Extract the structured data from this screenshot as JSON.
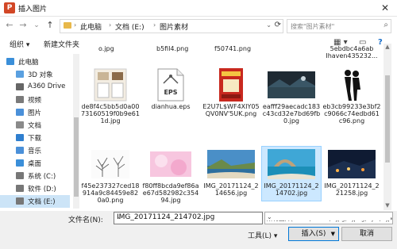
{
  "window": {
    "title": "插入图片",
    "app_icon_letter": "P",
    "close_glyph": "✕"
  },
  "nav": {
    "back_glyph": "←",
    "forward_glyph": "→",
    "dropdown_glyph": "⌄",
    "up_glyph": "↑",
    "breadcrumbs": [
      "此电脑",
      "文档 (E:)",
      "图片素材"
    ],
    "sep_glyph": "›",
    "refresh_glyph": "⟳",
    "search_placeholder": "搜索\"图片素材\""
  },
  "toolbar": {
    "organize": "组织 ▾",
    "new_folder": "新建文件夹",
    "view_glyph": "▦ ▾",
    "pane_glyph": "▭",
    "help_glyph": "?"
  },
  "sidebar": {
    "items": [
      {
        "label": "此电脑",
        "color": "#3b8fd9"
      },
      {
        "label": "3D 对象",
        "color": "#5aa0e0"
      },
      {
        "label": "A360 Drive",
        "color": "#666666"
      },
      {
        "label": "视频",
        "color": "#7a7a7a"
      },
      {
        "label": "图片",
        "color": "#4a90d9"
      },
      {
        "label": "文档",
        "color": "#8a8a8a"
      },
      {
        "label": "下载",
        "color": "#2f7fcf"
      },
      {
        "label": "音乐",
        "color": "#4a90d9"
      },
      {
        "label": "桌面",
        "color": "#3b8fd9"
      },
      {
        "label": "系统 (C:)",
        "color": "#777777"
      },
      {
        "label": "软件 (D:)",
        "color": "#777777"
      },
      {
        "label": "文档 (E:)",
        "color": "#777777"
      }
    ]
  },
  "files": {
    "prev_row": [
      "o.jpg",
      "b5fil4.png",
      "f50741.png",
      "5ebdbc4a6ab Ihaven435232..."
    ],
    "items": [
      {
        "name": "de8f4c5bb5d0a0073160519f0b9e611d.jpg",
        "thumb": "collage"
      },
      {
        "name": "dianhua.eps",
        "thumb": "eps"
      },
      {
        "name": "E2U7L$WF4XIY05QV0NV'5UK.png",
        "thumb": "poster"
      },
      {
        "name": "eafff29aecadc183c43cd32e7bd69fb0.jpg",
        "thumb": "dark-scene"
      },
      {
        "name": "eb3cb99233e3bf2c9066c74edbd61c96.png",
        "thumb": "couple"
      },
      {
        "name": "f45e237327ced18914a9c84459e820a0.png",
        "thumb": "tree"
      },
      {
        "name": "f80ff8bcda9ef86ae67d582982c35494.jpg",
        "thumb": "pink"
      },
      {
        "name": "IMG_20171124_214656.jpg",
        "thumb": "coast"
      },
      {
        "name": "IMG_20171124_214702.jpg",
        "thumb": "arch",
        "selected": true
      },
      {
        "name": "IMG_20171124_221258.jpg",
        "thumb": "night"
      }
    ]
  },
  "bottom": {
    "filename_label": "文件名(N):",
    "filename_value": "IMG_20171124_214702.jpg",
    "type_value": "所有图片(*.emf;*.wmf;*.jpg;*.jpeg;*.jfif;*.jpe;*.png)",
    "tools_label": "工具(L) ▾",
    "insert_label": "插入(S)",
    "cancel_label": "取消"
  }
}
